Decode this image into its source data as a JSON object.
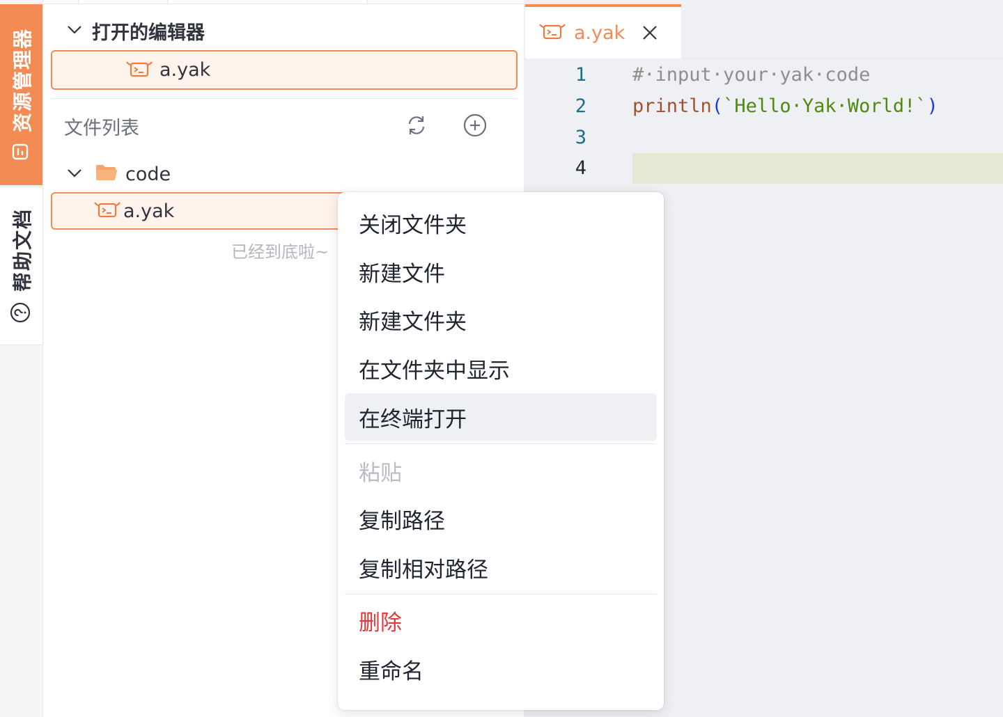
{
  "sidebar": {
    "tabs": [
      {
        "label": "资源管理器",
        "icon": "document-icon",
        "active": true
      },
      {
        "label": "帮助文档",
        "icon": "question-circle-icon",
        "active": false
      }
    ]
  },
  "explorer": {
    "open_editors": {
      "title": "打开的编辑器",
      "items": [
        {
          "name": "a.yak",
          "icon": "yak-file-icon"
        }
      ]
    },
    "file_list": {
      "title": "文件列表",
      "actions": [
        {
          "icon": "refresh-icon"
        },
        {
          "icon": "add-circle-icon"
        }
      ],
      "tree": {
        "folder": {
          "name": "code",
          "expanded": true
        },
        "files": [
          {
            "name": "a.yak",
            "selected": true
          }
        ]
      },
      "end_text": "已经到底啦~"
    }
  },
  "editor": {
    "tab": {
      "name": "a.yak"
    },
    "lines": [
      {
        "number": "1",
        "text": "#·input·your·yak·code"
      },
      {
        "number": "2",
        "fn": "println",
        "open": "(",
        "str": "`Hello·Yak·World!`",
        "close": ")"
      },
      {
        "number": "3",
        "text": ""
      },
      {
        "number": "4",
        "text": ""
      }
    ]
  },
  "context_menu": {
    "items": [
      "关闭文件夹",
      "新建文件",
      "新建文件夹",
      "在文件夹中显示",
      "在终端打开",
      "粘贴",
      "复制路径",
      "复制相对路径",
      "删除",
      "重命名"
    ],
    "hovered": "在终端打开",
    "disabled": "粘贴",
    "danger": "删除"
  },
  "colors": {
    "accent": "#f28b54",
    "accent_bg": "#fff3ec",
    "danger": "#e8353a",
    "editor_bg": "#eef0f4"
  }
}
